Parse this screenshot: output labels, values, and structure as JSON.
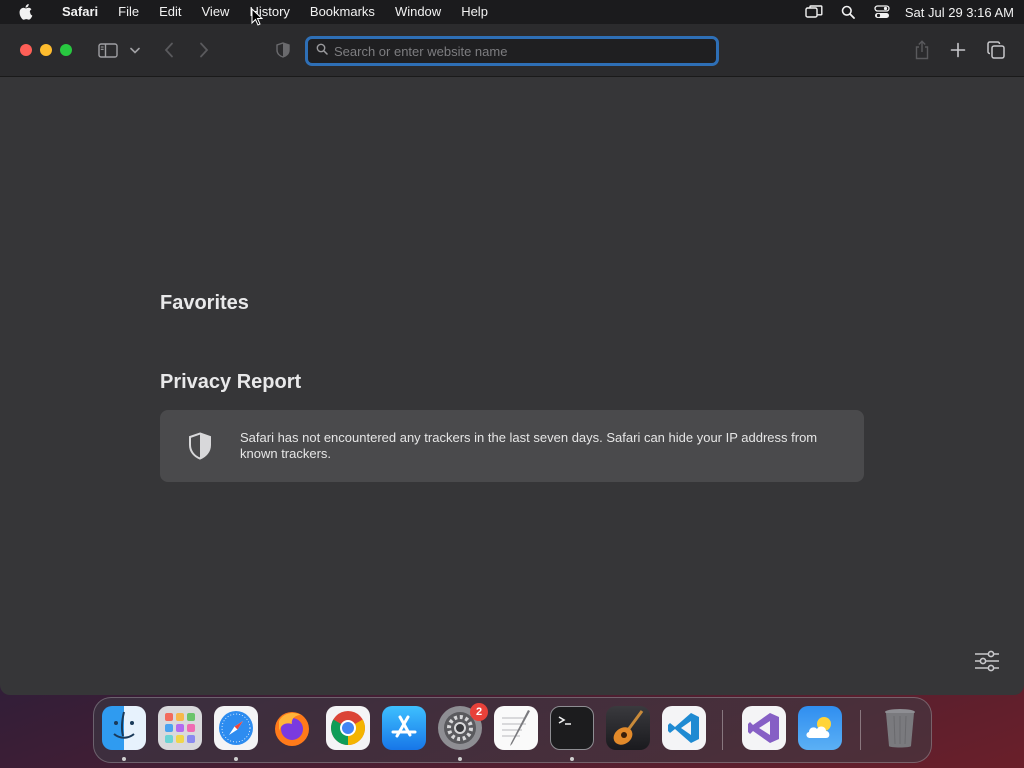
{
  "menubar": {
    "app_name": "Safari",
    "items": [
      "File",
      "Edit",
      "View",
      "History",
      "Bookmarks",
      "Window",
      "Help"
    ],
    "clock": "Sat Jul 29  3:16 AM",
    "status_icons": [
      "screen-mirroring-icon",
      "spotlight-search-icon",
      "control-center-icon"
    ]
  },
  "toolbar": {
    "search_placeholder": "Search or enter website name",
    "search_value": ""
  },
  "content": {
    "favorites_title": "Favorites",
    "privacy_title": "Privacy Report",
    "privacy_text": "Safari has not encountered any trackers in the last seven days. Safari can hide your IP address from known trackers."
  },
  "dock": {
    "apps": [
      "Finder",
      "Launchpad",
      "Safari",
      "Firefox",
      "Google Chrome",
      "App Store",
      "System Settings",
      "TextEdit",
      "Terminal",
      "GarageBand",
      "Visual Studio Code",
      "Visual Studio",
      "Weather",
      "Trash"
    ],
    "system_settings_badge": "2"
  },
  "colors": {
    "window_bg": "#363638",
    "toolbar_bg": "#2b2b2d",
    "focus_ring": "#2e6fb6",
    "card_bg": "#4a4a4c"
  }
}
